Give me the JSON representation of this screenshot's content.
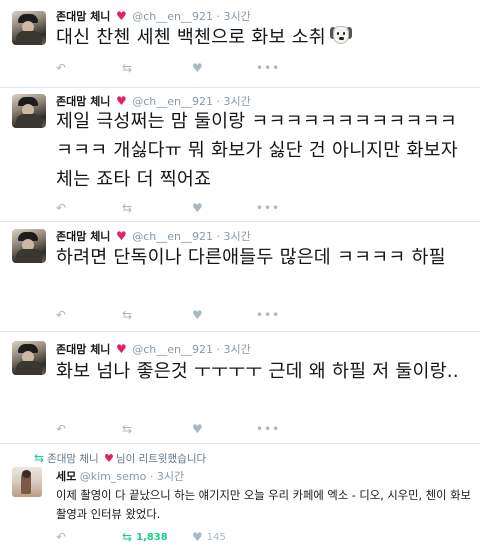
{
  "author": {
    "name": "존대맘 체니",
    "heart": "♥",
    "handle": "@ch__en__921",
    "dot": "·",
    "time": "3시간"
  },
  "icons": {
    "reply": "↶",
    "retweet": "⇆",
    "like": "♥",
    "more": "•••",
    "avatar": "profile-photo"
  },
  "colors": {
    "heart": "#e0245e",
    "retweet_active": "#19cf86",
    "meta": "#8899a6"
  },
  "tweets": [
    {
      "text": "대신 찬첸 세첸 백첸으로 화보 소취",
      "emoji": "dog-face"
    },
    {
      "text": "제일 극성쩌는 맘 둘이랑 ㅋㅋㅋㅋㅋㅋㅋㅋㅋㅋㅋㅋㅋㅋㅋ 개싫다ㅠ 뭐 화보가 싫단 건 아니지만 화보자체는 죠타 더 찍어죠"
    },
    {
      "text": "하려면 단독이나 다른애들두 많은데 ㅋㅋㅋㅋ 하필"
    },
    {
      "text": "화보 넘나 좋은것 ㅜㅜㅜㅜ 근데 왜 하필 저 둘이랑.."
    }
  ],
  "retweet": {
    "context_name": "존대맘 체니",
    "context_suffix": "님이 리트윗했습니다",
    "author_name": "세모",
    "handle": "@kim_semo",
    "dot": "·",
    "time": "3시간",
    "text": "이제 촬영이 다 끝났으니 하는 얘기지만 오늘 우리 카페에 엑소 - 디오, 시우민, 첸이 화보 촬영과 인터뷰 왔었다.",
    "retweet_count": "1,838",
    "like_count": "145"
  }
}
